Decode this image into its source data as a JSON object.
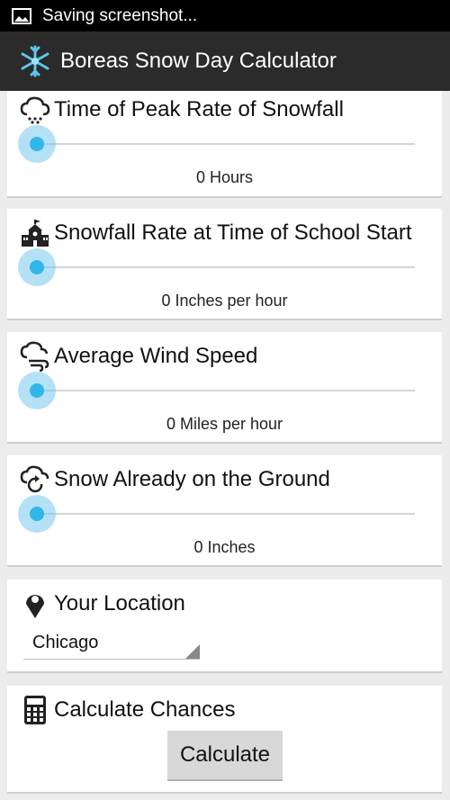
{
  "status_bar": {
    "text": "Saving screenshot..."
  },
  "app_bar": {
    "title": "Boreas Snow Day Calculator"
  },
  "cards": {
    "peak": {
      "title": "Time of Peak Rate of Snowfall",
      "slider_value": 0,
      "value_label": "0 Hours"
    },
    "rate": {
      "title": "Snowfall Rate at Time of School Start",
      "slider_value": 0,
      "value_label": "0 Inches per hour"
    },
    "wind": {
      "title": "Average Wind Speed",
      "slider_value": 0,
      "value_label": "0 Miles per hour"
    },
    "ground": {
      "title": "Snow Already on the Ground",
      "slider_value": 0,
      "value_label": "0 Inches"
    },
    "location": {
      "title": "Your Location",
      "selected": "Chicago"
    },
    "calculate": {
      "title": "Calculate Chances",
      "button_label": "Calculate"
    }
  },
  "colors": {
    "accent": "#31b6e7",
    "action_bar": "#2b2b2b",
    "background": "#ececec"
  },
  "icons": [
    "image-icon",
    "snowflake-icon",
    "snow-cloud-icon",
    "school-icon",
    "wind-cloud-icon",
    "cloud-refresh-icon",
    "location-pin-icon",
    "calculator-icon"
  ]
}
